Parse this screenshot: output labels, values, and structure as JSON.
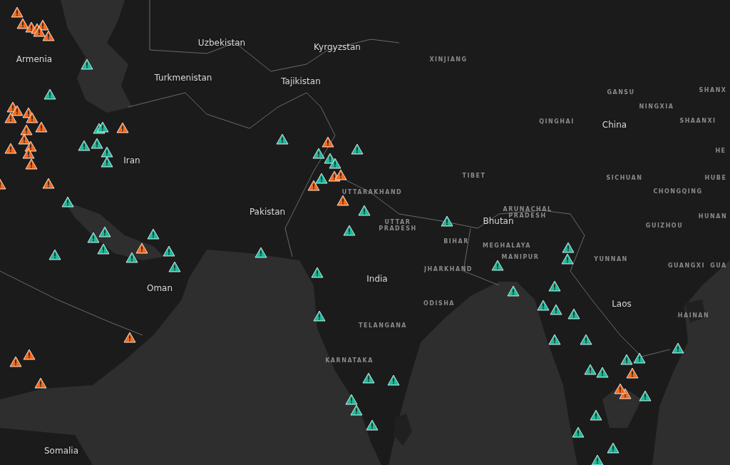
{
  "map": {
    "labels": [
      {
        "kind": "country",
        "text": "Uzbekistan"
      },
      {
        "kind": "country",
        "text": "Kyrgyzstan"
      },
      {
        "kind": "country",
        "text": "Armenia"
      },
      {
        "kind": "region",
        "text": "XINJIANG"
      },
      {
        "kind": "country",
        "text": "Turkmenistan"
      },
      {
        "kind": "country",
        "text": "Tajikistan"
      },
      {
        "kind": "region",
        "text": "SHANX"
      },
      {
        "kind": "region",
        "text": "GANSU"
      },
      {
        "kind": "region",
        "text": "NINGXIA"
      },
      {
        "kind": "region",
        "text": "QINGHAI"
      },
      {
        "kind": "country",
        "text": "China"
      },
      {
        "kind": "region",
        "text": "SHAANXI"
      },
      {
        "kind": "region",
        "text": "HE"
      },
      {
        "kind": "country",
        "text": "Iran"
      },
      {
        "kind": "region",
        "text": "TIBET"
      },
      {
        "kind": "region",
        "text": "SICHUAN"
      },
      {
        "kind": "region",
        "text": "HUBE"
      },
      {
        "kind": "region",
        "text": "UTTARAKHAND"
      },
      {
        "kind": "region",
        "text": "CHONGQING"
      },
      {
        "kind": "country",
        "text": "Pakistan"
      },
      {
        "kind": "region",
        "text": "ARUNACHAL PRADESH"
      },
      {
        "kind": "region",
        "text": "HUNAN"
      },
      {
        "kind": "region",
        "text": "UTTAR PRADESH"
      },
      {
        "kind": "country",
        "text": "Bhutan"
      },
      {
        "kind": "region",
        "text": "GUIZHOU"
      },
      {
        "kind": "region",
        "text": "BIHAR"
      },
      {
        "kind": "region",
        "text": "MEGHALAYA"
      },
      {
        "kind": "region",
        "text": "MANIPUR"
      },
      {
        "kind": "region",
        "text": "YUNNAN"
      },
      {
        "kind": "region",
        "text": "GUANGXI"
      },
      {
        "kind": "region",
        "text": "GUA"
      },
      {
        "kind": "region",
        "text": "JHARKHAND"
      },
      {
        "kind": "country",
        "text": "India"
      },
      {
        "kind": "country",
        "text": "Oman"
      },
      {
        "kind": "region",
        "text": "ODISHA"
      },
      {
        "kind": "country",
        "text": "Laos"
      },
      {
        "kind": "region",
        "text": "HAINAN"
      },
      {
        "kind": "region",
        "text": "TELANGANA"
      },
      {
        "kind": "region",
        "text": "KARNATAKA"
      },
      {
        "kind": "country",
        "text": "Somalia"
      }
    ],
    "markers": [
      {
        "color": "#f4691b"
      },
      {
        "color": "#f4691b"
      },
      {
        "color": "#f4691b"
      },
      {
        "color": "#f4691b"
      },
      {
        "color": "#f4691b"
      },
      {
        "color": "#f4691b"
      },
      {
        "color": "#f4691b"
      },
      {
        "color": "#f4691b"
      },
      {
        "color": "#f4691b"
      },
      {
        "color": "#f4691b"
      },
      {
        "color": "#f4691b"
      },
      {
        "color": "#f4691b"
      },
      {
        "color": "#f4691b"
      },
      {
        "color": "#f4691b"
      },
      {
        "color": "#f4691b"
      },
      {
        "color": "#f4691b"
      },
      {
        "color": "#f4691b"
      },
      {
        "color": "#f4691b"
      },
      {
        "color": "#f4691b"
      },
      {
        "color": "#f4691b"
      },
      {
        "color": "#f4691b"
      },
      {
        "color": "#f4691b"
      },
      {
        "color": "#f4691b"
      },
      {
        "color": "#f4691b"
      },
      {
        "color": "#f4691b"
      },
      {
        "color": "#f4691b"
      },
      {
        "color": "#f4691b"
      },
      {
        "color": "#f4691b"
      },
      {
        "color": "#f4691b"
      },
      {
        "color": "#f4691b"
      },
      {
        "color": "#f4691b"
      },
      {
        "color": "#f4691b"
      },
      {
        "color": "#f4691b"
      },
      {
        "color": "#f4691b"
      },
      {
        "color": "#f4691b"
      },
      {
        "color": "#1db99a"
      },
      {
        "color": "#1db99a"
      },
      {
        "color": "#1db99a"
      },
      {
        "color": "#1db99a"
      },
      {
        "color": "#1db99a"
      },
      {
        "color": "#1db99a"
      },
      {
        "color": "#1db99a"
      },
      {
        "color": "#1db99a"
      },
      {
        "color": "#1db99a"
      },
      {
        "color": "#1db99a"
      },
      {
        "color": "#1db99a"
      },
      {
        "color": "#1db99a"
      },
      {
        "color": "#1db99a"
      },
      {
        "color": "#1db99a"
      },
      {
        "color": "#1db99a"
      },
      {
        "color": "#1db99a"
      },
      {
        "color": "#1db99a"
      },
      {
        "color": "#1db99a"
      },
      {
        "color": "#1db99a"
      },
      {
        "color": "#1db99a"
      },
      {
        "color": "#1db99a"
      },
      {
        "color": "#1db99a"
      },
      {
        "color": "#1db99a"
      },
      {
        "color": "#1db99a"
      },
      {
        "color": "#1db99a"
      },
      {
        "color": "#1db99a"
      },
      {
        "color": "#1db99a"
      },
      {
        "color": "#1db99a"
      },
      {
        "color": "#1db99a"
      },
      {
        "color": "#1db99a"
      },
      {
        "color": "#1db99a"
      },
      {
        "color": "#1db99a"
      },
      {
        "color": "#1db99a"
      },
      {
        "color": "#1db99a"
      },
      {
        "color": "#1db99a"
      },
      {
        "color": "#1db99a"
      },
      {
        "color": "#1db99a"
      },
      {
        "color": "#1db99a"
      },
      {
        "color": "#1db99a"
      },
      {
        "color": "#1db99a"
      },
      {
        "color": "#1db99a"
      },
      {
        "color": "#1db99a"
      },
      {
        "color": "#1db99a"
      },
      {
        "color": "#1db99a"
      },
      {
        "color": "#1db99a"
      },
      {
        "color": "#1db99a"
      },
      {
        "color": "#1db99a"
      },
      {
        "color": "#1db99a"
      },
      {
        "color": "#1db99a"
      },
      {
        "color": "#1db99a"
      },
      {
        "color": "#1db99a"
      },
      {
        "color": "#1db99a"
      },
      {
        "color": "#1db99a"
      },
      {
        "color": "#1db99a"
      }
    ]
  }
}
